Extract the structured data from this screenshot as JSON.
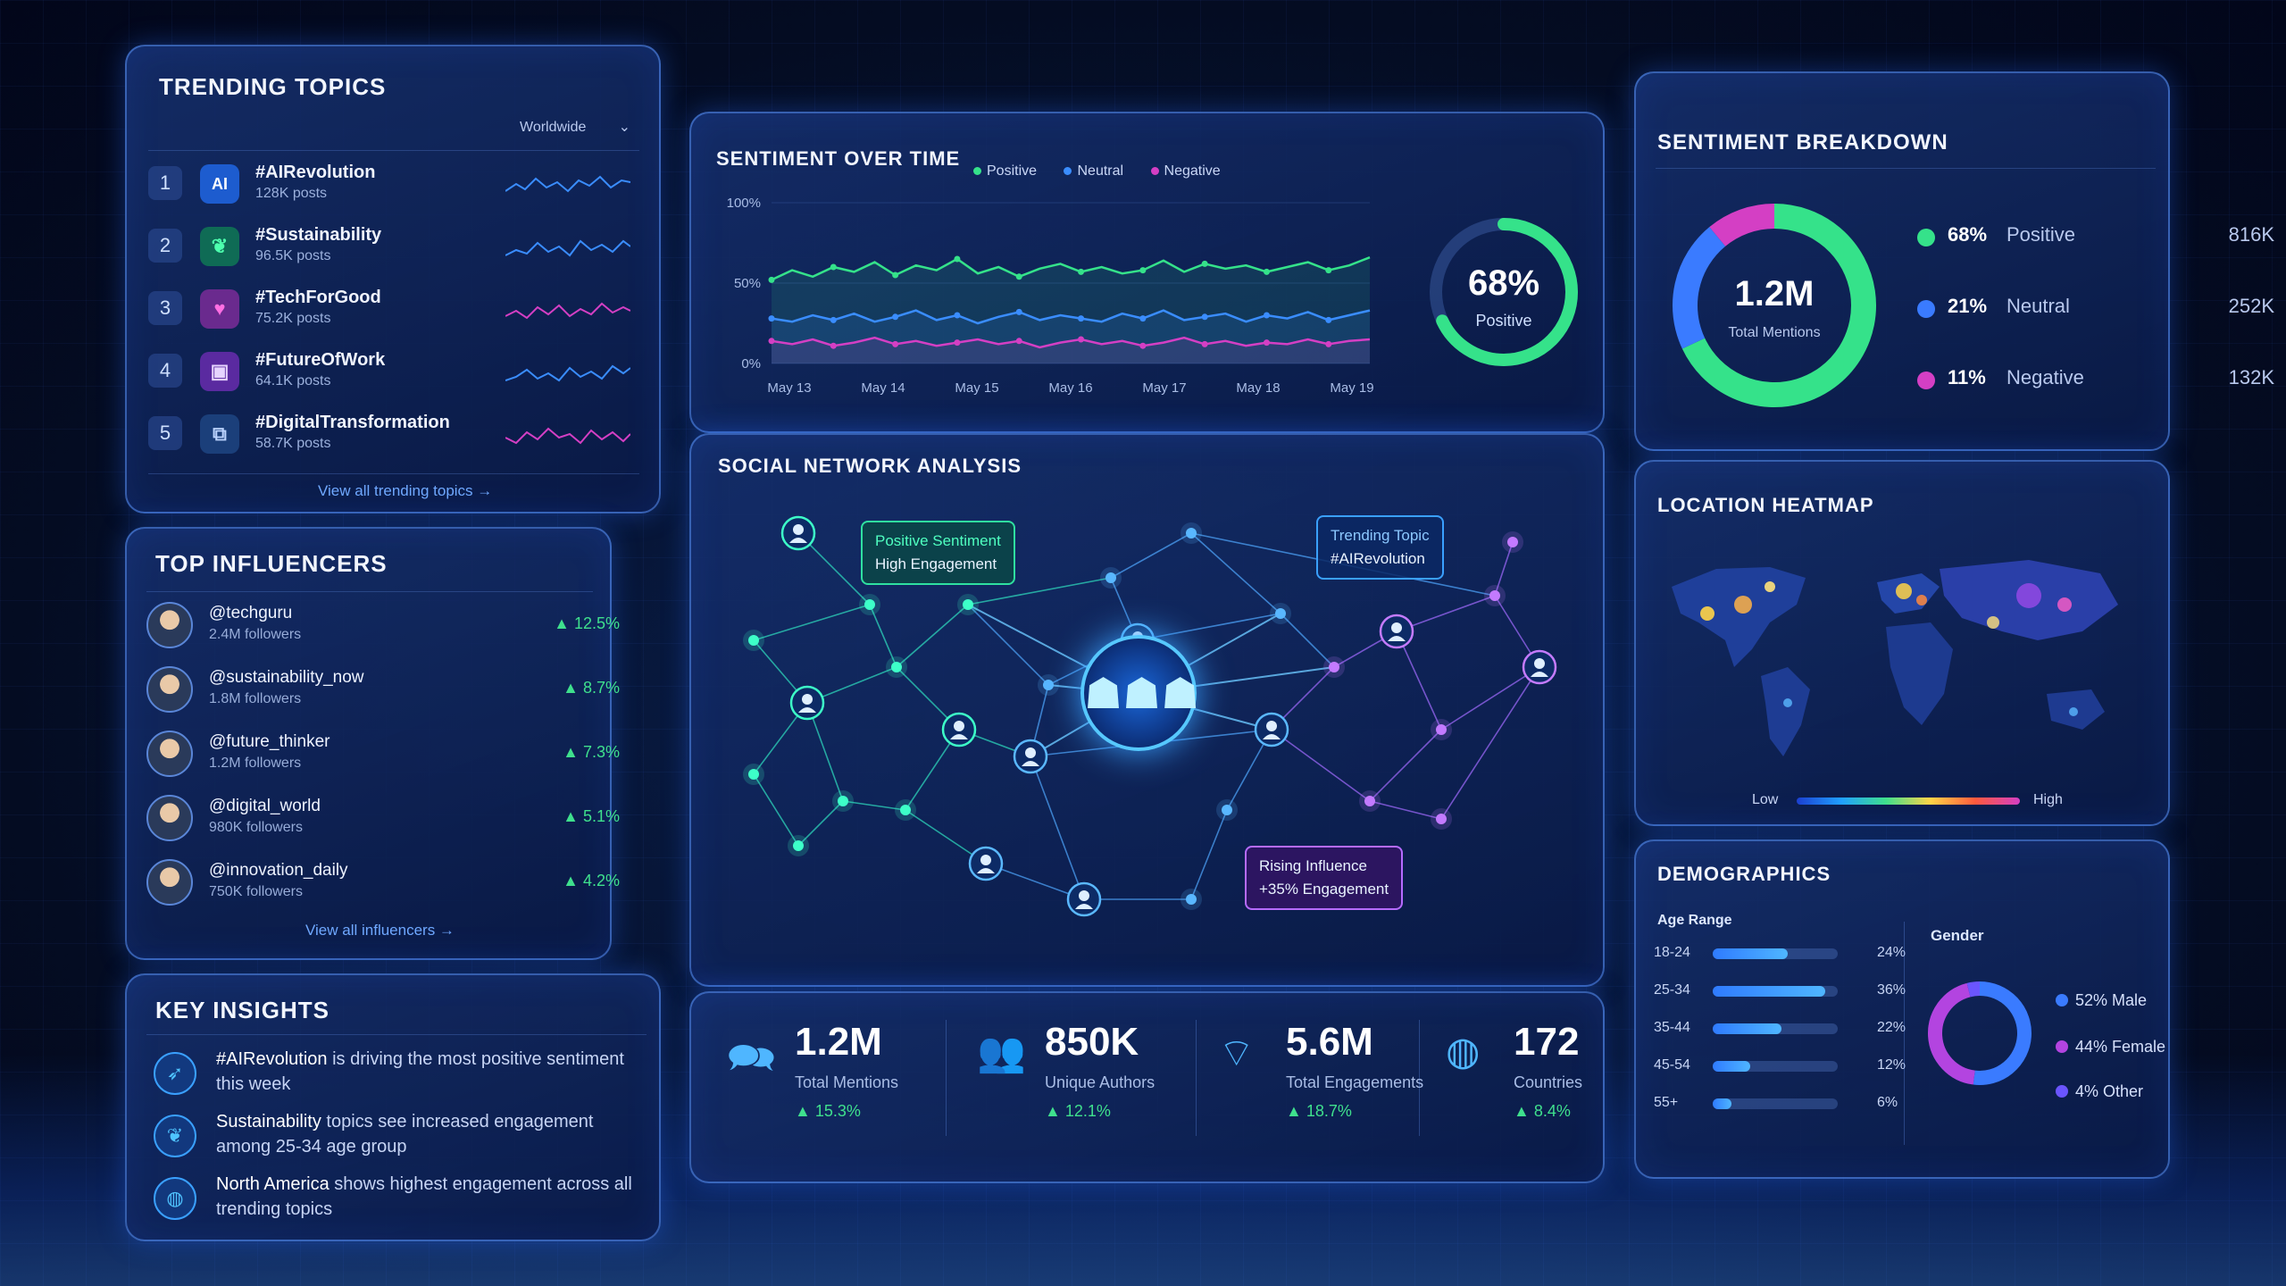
{
  "trending": {
    "title": "Trending Topics",
    "region": "Worldwide",
    "items": [
      {
        "rank": "1",
        "tag": "#AIRevolution",
        "posts": "128K posts",
        "icon": "AI"
      },
      {
        "rank": "2",
        "tag": "#Sustainability",
        "posts": "96.5K posts",
        "icon": "leaf-icon"
      },
      {
        "rank": "3",
        "tag": "#TechForGood",
        "posts": "75.2K posts",
        "icon": "heart-icon"
      },
      {
        "rank": "4",
        "tag": "#FutureOfWork",
        "posts": "64.1K posts",
        "icon": "briefcase-icon"
      },
      {
        "rank": "5",
        "tag": "#DigitalTransformation",
        "posts": "58.7K posts",
        "icon": "transform-icon"
      }
    ],
    "view_all": "View all trending topics →"
  },
  "influencers": {
    "title": "Top Influencers",
    "items": [
      {
        "handle": "@techguru",
        "followers": "2.4M followers",
        "change": "▲ 12.5%"
      },
      {
        "handle": "@sustainability_now",
        "followers": "1.8M followers",
        "change": "▲ 8.7%"
      },
      {
        "handle": "@future_thinker",
        "followers": "1.2M followers",
        "change": "▲ 7.3%"
      },
      {
        "handle": "@digital_world",
        "followers": "980K followers",
        "change": "▲ 5.1%"
      },
      {
        "handle": "@innovation_daily",
        "followers": "750K followers",
        "change": "▲ 4.2%"
      }
    ],
    "view_all": "View all influencers →"
  },
  "insights": {
    "title": "Key Insights",
    "items": [
      {
        "strong": "#AIRevolution",
        "rest": " is driving the most positive sentiment this week"
      },
      {
        "strong": "Sustainability",
        "rest": " topics see increased engagement among 25-34 age group"
      },
      {
        "strong": "North America",
        "rest": " shows highest engagement across all trending topics"
      }
    ]
  },
  "sentiment_time": {
    "title": "Sentiment Over Time",
    "legend": [
      "Positive",
      "Neutral",
      "Negative"
    ],
    "gauge_value": "68%",
    "gauge_label": "Positive"
  },
  "chart_data": {
    "type": "line",
    "x": [
      "May 13",
      "May 14",
      "May 15",
      "May 16",
      "May 17",
      "May 18",
      "May 19"
    ],
    "y_ticks": [
      "100%",
      "50%",
      "0%"
    ],
    "ylim": [
      0,
      100
    ],
    "series": [
      {
        "name": "Positive",
        "color": "#35e28a",
        "values": [
          52,
          58,
          54,
          60,
          57,
          63,
          55,
          61,
          58,
          65,
          56,
          60,
          54,
          59,
          62,
          57,
          60,
          56,
          58,
          64,
          57,
          62,
          59,
          61,
          57,
          60,
          63,
          58,
          61,
          66
        ]
      },
      {
        "name": "Neutral",
        "color": "#3a8dff",
        "values": [
          28,
          26,
          30,
          27,
          31,
          26,
          29,
          33,
          27,
          30,
          25,
          29,
          32,
          27,
          30,
          28,
          26,
          31,
          28,
          33,
          27,
          29,
          31,
          26,
          30,
          28,
          32,
          27,
          30,
          33
        ]
      },
      {
        "name": "Negative",
        "color": "#d43fc4",
        "values": [
          14,
          12,
          15,
          11,
          13,
          16,
          12,
          14,
          11,
          13,
          15,
          12,
          14,
          10,
          13,
          15,
          12,
          14,
          11,
          13,
          16,
          12,
          14,
          11,
          13,
          12,
          15,
          12,
          14,
          15
        ]
      }
    ]
  },
  "network": {
    "title": "Social Network Analysis",
    "callout_positive": [
      "Positive Sentiment",
      "High Engagement"
    ],
    "callout_trending": [
      "Trending Topic",
      "#AIRevolution"
    ],
    "callout_rising": [
      "Rising Influence",
      "+35% Engagement"
    ]
  },
  "stats": [
    {
      "value": "1.2M",
      "label": "Total Mentions",
      "change": "▲ 15.3%",
      "icon": "chat-icon"
    },
    {
      "value": "850K",
      "label": "Unique Authors",
      "change": "▲ 12.1%",
      "icon": "users-icon"
    },
    {
      "value": "5.6M",
      "label": "Total Engagements",
      "change": "▲ 18.7%",
      "icon": "wifi-icon"
    },
    {
      "value": "172",
      "label": "Countries",
      "change": "▲ 8.4%",
      "icon": "globe-icon"
    }
  ],
  "breakdown": {
    "title": "Sentiment Breakdown",
    "total": "1.2M",
    "total_label": "Total Mentions",
    "items": [
      {
        "pct": "68%",
        "label": "Positive",
        "count": "816K",
        "color": "#35e28a",
        "share": 0.68
      },
      {
        "pct": "21%",
        "label": "Neutral",
        "count": "252K",
        "color": "#3a7bff",
        "share": 0.21
      },
      {
        "pct": "11%",
        "label": "Negative",
        "count": "132K",
        "color": "#d43fc4",
        "share": 0.11
      }
    ]
  },
  "heatmap": {
    "title": "Location Heatmap",
    "low": "Low",
    "high": "High"
  },
  "demographics": {
    "title": "Demographics",
    "age_title": "Age Range",
    "gender_title": "Gender",
    "ages": [
      {
        "range": "18-24",
        "pct": "24%",
        "share": 0.24
      },
      {
        "range": "25-34",
        "pct": "36%",
        "share": 0.36
      },
      {
        "range": "35-44",
        "pct": "22%",
        "share": 0.22
      },
      {
        "range": "45-54",
        "pct": "12%",
        "share": 0.12
      },
      {
        "range": "55+",
        "pct": "6%",
        "share": 0.06
      }
    ],
    "gender": [
      {
        "label": "52% Male",
        "color": "#3a7bff",
        "share": 0.52
      },
      {
        "label": "44% Female",
        "color": "#b344e0",
        "share": 0.44
      },
      {
        "label": "4% Other",
        "color": "#6b55ff",
        "share": 0.04
      }
    ]
  }
}
